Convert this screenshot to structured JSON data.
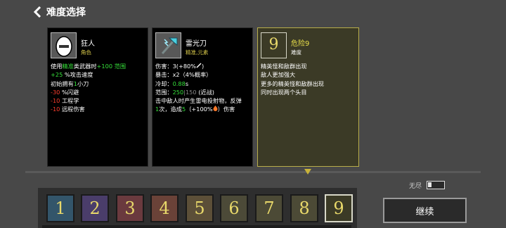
{
  "header": {
    "title": "难度选择"
  },
  "cards": [
    {
      "name": "狂人",
      "type": "角色",
      "lines": [
        {
          "a": "使用",
          "b": "精准",
          "c": "类武器时",
          "d": "+100 范围"
        },
        {
          "a": "+25",
          "b": "%攻击速度"
        },
        {
          "a": "初始拥有",
          "b": "1",
          "c": "小刀"
        },
        {
          "a": "-30",
          "b": "%闪避"
        },
        {
          "a": "-10",
          "b": "工程学"
        },
        {
          "a": "-10",
          "b": "远程伤害"
        }
      ]
    },
    {
      "name": "雷光刀",
      "type": "精准,元素",
      "lines": [
        {
          "a": "伤害：3(+80%",
          "b": ")"
        },
        {
          "a": "暴击：x2（4%概率）"
        },
        {
          "a": "冷却：",
          "b": "0.88",
          "c": "s"
        },
        {
          "a": "范围：",
          "b": "250",
          "c": "|150",
          "d": "(近战)"
        },
        {
          "a": "击中敌人时产生雷电投射物，反弹"
        },
        {
          "a": "1",
          "b": "次，造成",
          "c": "5",
          "d": "（+100%",
          "e": "）伤害"
        }
      ]
    },
    {
      "name": "危险9",
      "type": "难度",
      "icon_text": "9",
      "lines": [
        "精英怪和敌群出现",
        "敌人更加强大",
        "更多的精英怪和敌群出现",
        "同时出现两个头目"
      ]
    }
  ],
  "difficulty_levels": [
    {
      "label": "1",
      "color": "#33556a"
    },
    {
      "label": "2",
      "color": "#4a3d6a"
    },
    {
      "label": "3",
      "color": "#6a3a3e"
    },
    {
      "label": "4",
      "color": "#6a4238"
    },
    {
      "label": "5",
      "color": "#5c4f38"
    },
    {
      "label": "6",
      "color": "#4c4a38"
    },
    {
      "label": "7",
      "color": "#4c4a36"
    },
    {
      "label": "8",
      "color": "#4c4a36"
    },
    {
      "label": "9",
      "color": "#3b3a26"
    }
  ],
  "selected_level": "9",
  "endless": {
    "label": "无尽",
    "enabled": false
  },
  "continue_label": "继续",
  "icons": {
    "back": "chevron-left-icon",
    "egg": "egg-portrait-icon",
    "axe": "lightning-axe-icon",
    "sword": "sword-icon",
    "fire": "fire-icon"
  }
}
